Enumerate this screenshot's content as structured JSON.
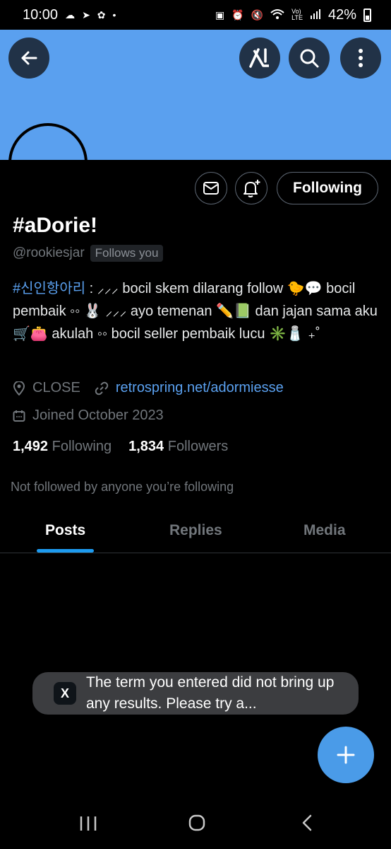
{
  "status_bar": {
    "time": "10:00",
    "battery": "42%",
    "left_icons": [
      "cloud-icon",
      "telegram-icon",
      "settings-icon",
      "dot-icon"
    ],
    "right_icons": [
      "sim-icon",
      "alarm-icon",
      "mute-icon",
      "wifi-icon",
      "volte-icon",
      "signal-icon",
      "battery-icon"
    ]
  },
  "header": {
    "back_icon": "arrow-left-icon",
    "grok_icon": "grok-icon",
    "search_icon": "search-icon",
    "more_icon": "more-vertical-icon",
    "banner_color": "#5aa0ef"
  },
  "profile": {
    "following_button": "Following",
    "display_name": "#aDorie!",
    "handle": "@rookiesjar",
    "follows_you": "Follows you",
    "bio_tag": "#신인항아리",
    "bio_rest": " : ⸝⸝⸝ bocil skem dilarang follow 🐤💬 bocil pembaik ◦◦ 🐰 ⸝⸝⸝ ayo temenan ✏️📗 dan jajan sama aku 🛒👛 akulah ◦◦ bocil seller pembaik lucu ✳️🧂 ₊˚",
    "location": "CLOSE",
    "link": "retrospring.net/adormiesse",
    "joined": "Joined October 2023",
    "following_count": "1,492",
    "following_label": "Following",
    "followers_count": "1,834",
    "followers_label": "Followers",
    "not_followed": "Not followed by anyone you’re following"
  },
  "tabs": [
    {
      "label": "Posts",
      "active": true
    },
    {
      "label": "Replies",
      "active": false
    },
    {
      "label": "Media",
      "active": false
    }
  ],
  "toast": {
    "badge": "X",
    "text": "The term you entered did not bring up any results. Please try a..."
  },
  "fab": {
    "icon": "plus-icon"
  },
  "colors": {
    "accent": "#1d9bf0",
    "link": "#5aa0ef",
    "muted": "#71767b"
  }
}
